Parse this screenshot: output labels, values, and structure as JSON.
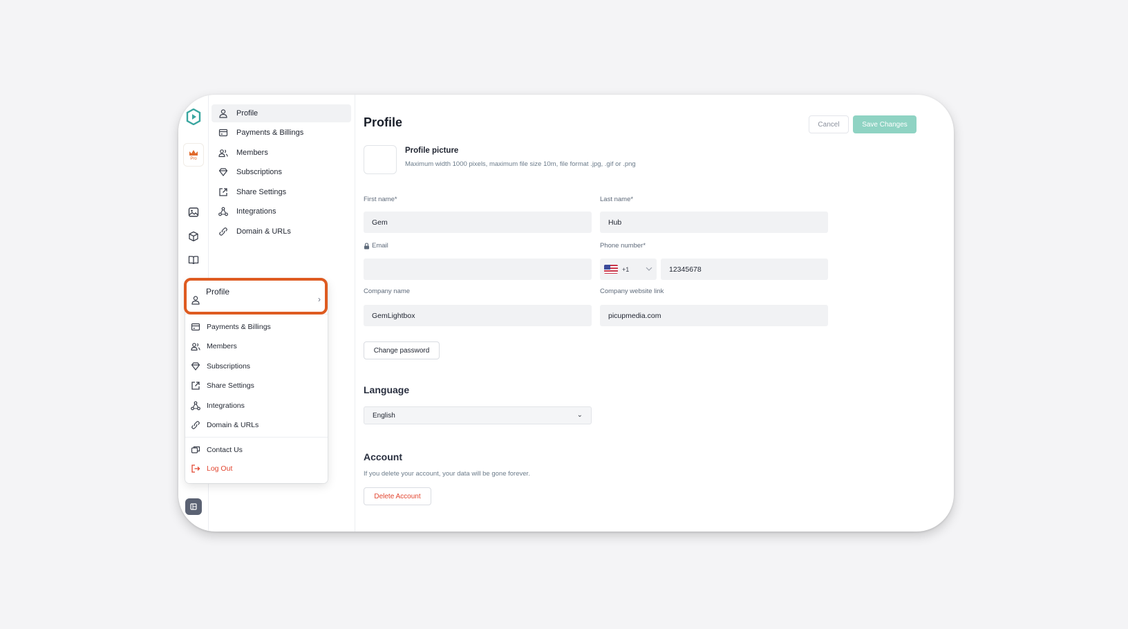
{
  "colors": {
    "accent": "#de5b21",
    "save_button": "#8fd3c3",
    "danger": "#e2452f",
    "brand": "#3aa6a0"
  },
  "rail": {
    "pro_label": "Pro",
    "icons": [
      "logo-icon",
      "crown-icon",
      "image-icon",
      "box-icon",
      "book-icon",
      "building-icon"
    ]
  },
  "subnav": {
    "items": [
      {
        "label": "Profile",
        "icon": "user-icon"
      },
      {
        "label": "Payments & Billings",
        "icon": "card-icon"
      },
      {
        "label": "Members",
        "icon": "users-icon"
      },
      {
        "label": "Subscriptions",
        "icon": "diamond-icon"
      },
      {
        "label": "Share Settings",
        "icon": "share-icon"
      },
      {
        "label": "Integrations",
        "icon": "integrations-icon"
      },
      {
        "label": "Domain & URLs",
        "icon": "link-icon"
      }
    ]
  },
  "dropdown": {
    "header": "Profile",
    "items": [
      {
        "label": "Payments & Billings"
      },
      {
        "label": "Members"
      },
      {
        "label": "Subscriptions"
      },
      {
        "label": "Share Settings"
      },
      {
        "label": "Integrations"
      },
      {
        "label": "Domain & URLs"
      }
    ],
    "contact": "Contact Us",
    "logout": "Log Out"
  },
  "main": {
    "title": "Profile",
    "cancel": "Cancel",
    "save": "Save Changes",
    "picture_title": "Profile picture",
    "picture_sub": "Maximum width 1000 pixels, maximum file size 10m, file format .jpg, .gif or .png",
    "first_name_label": "First name*",
    "first_name": "Gem",
    "last_name_label": "Last name*",
    "last_name": "Hub",
    "email_label": "Email",
    "email": "",
    "phone_label": "Phone number*",
    "phone_code": "+1",
    "phone": "12345678",
    "company_label": "Company name",
    "company": "GemLightbox",
    "website_label": "Company website link",
    "website": "picupmedia.com",
    "change_password": "Change password",
    "language_title": "Language",
    "language_value": "English",
    "account_title": "Account",
    "account_sub": "If you delete your account, your data will be gone forever.",
    "delete": "Delete Account"
  }
}
